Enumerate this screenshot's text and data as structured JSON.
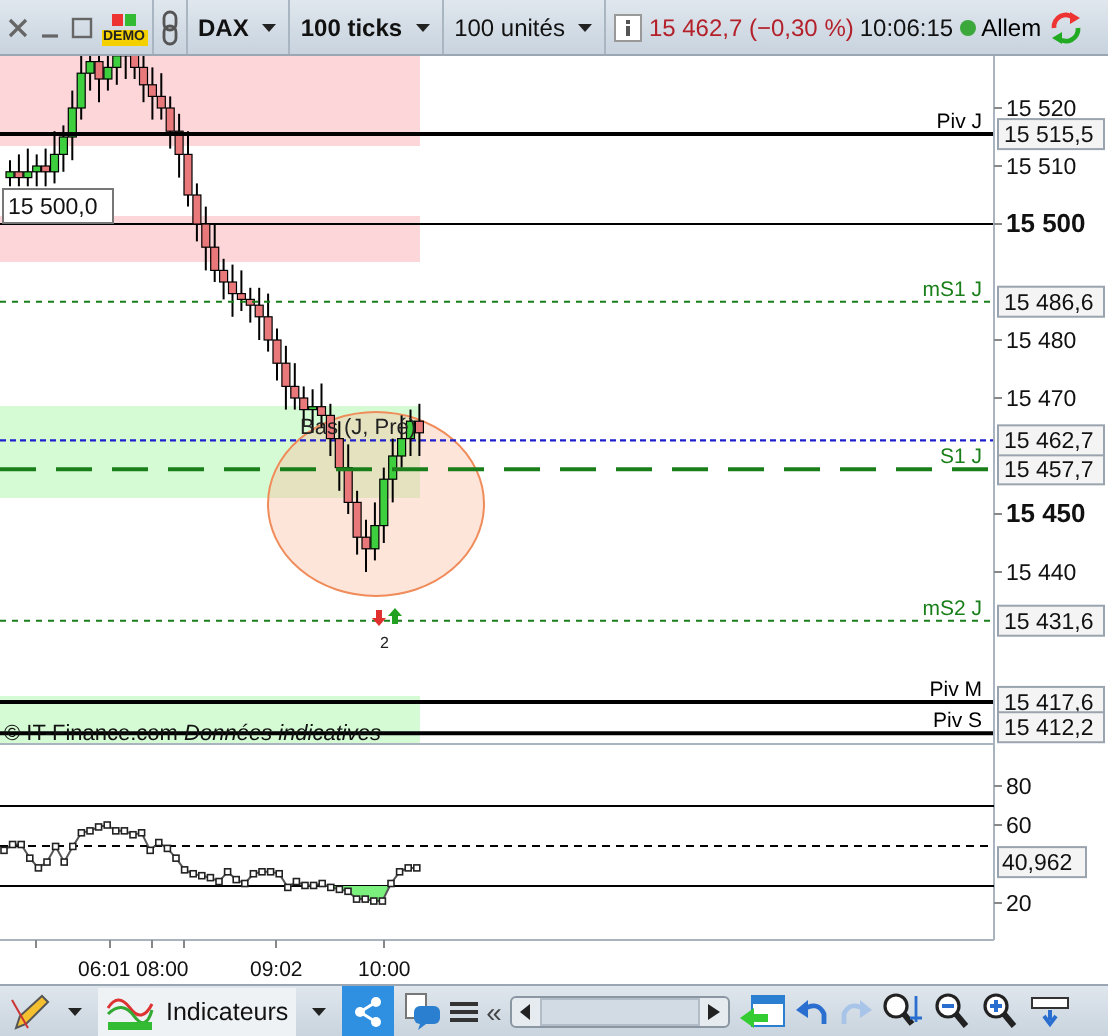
{
  "toolbar": {
    "demo_badge": "DEMO",
    "instrument": "DAX",
    "period": "100 ticks",
    "units": "100 unités",
    "price_change": "15 462,7 (−0,30 %)",
    "time": "10:06:15",
    "market": "Allem",
    "market_open": true
  },
  "price_axis": {
    "ticks": [
      {
        "label": "15 520",
        "major": false
      },
      {
        "label": "15 510",
        "major": false
      },
      {
        "label": "15 500",
        "major": true
      },
      {
        "label": "15 480",
        "major": false
      },
      {
        "label": "15 470",
        "major": false
      },
      {
        "label": "15 450",
        "major": true
      },
      {
        "label": "15 440",
        "major": false
      }
    ]
  },
  "levels": [
    {
      "label": "Piv J",
      "value": "15 515,5",
      "kind": "thick",
      "color": "#000000"
    },
    {
      "label": "mS1 J",
      "value": "15 486,6",
      "kind": "dashed",
      "color": "#1a7f1a"
    },
    {
      "label": "S1 J",
      "value": "15 457,7",
      "kind": "longdash",
      "color": "#1a7f1a"
    },
    {
      "label": "mS2 J",
      "value": "15 431,6",
      "kind": "dashed",
      "color": "#1a7f1a"
    },
    {
      "label": "Piv M",
      "value": "15 417,6",
      "kind": "thick",
      "color": "#000000"
    },
    {
      "label": "Piv S",
      "value": "15 412,2",
      "kind": "thick",
      "color": "#000000"
    }
  ],
  "current_price": {
    "value": "15 462,7"
  },
  "cursor_label": "15 500,0",
  "annotation": "Bas (J, Pré)",
  "signal_count": "2",
  "notice": "© IT-Finance.com *Données indicatives*",
  "indicator": {
    "ticks": [
      "80",
      "60",
      "20"
    ],
    "value": "40,962"
  },
  "time_axis": [
    "06:01",
    "08:00",
    "09:02",
    "10:00"
  ],
  "bottom_toolbar": {
    "indicators_label": "Indicateurs",
    "scroll_left": "«",
    "redo_disabled": true
  }
}
